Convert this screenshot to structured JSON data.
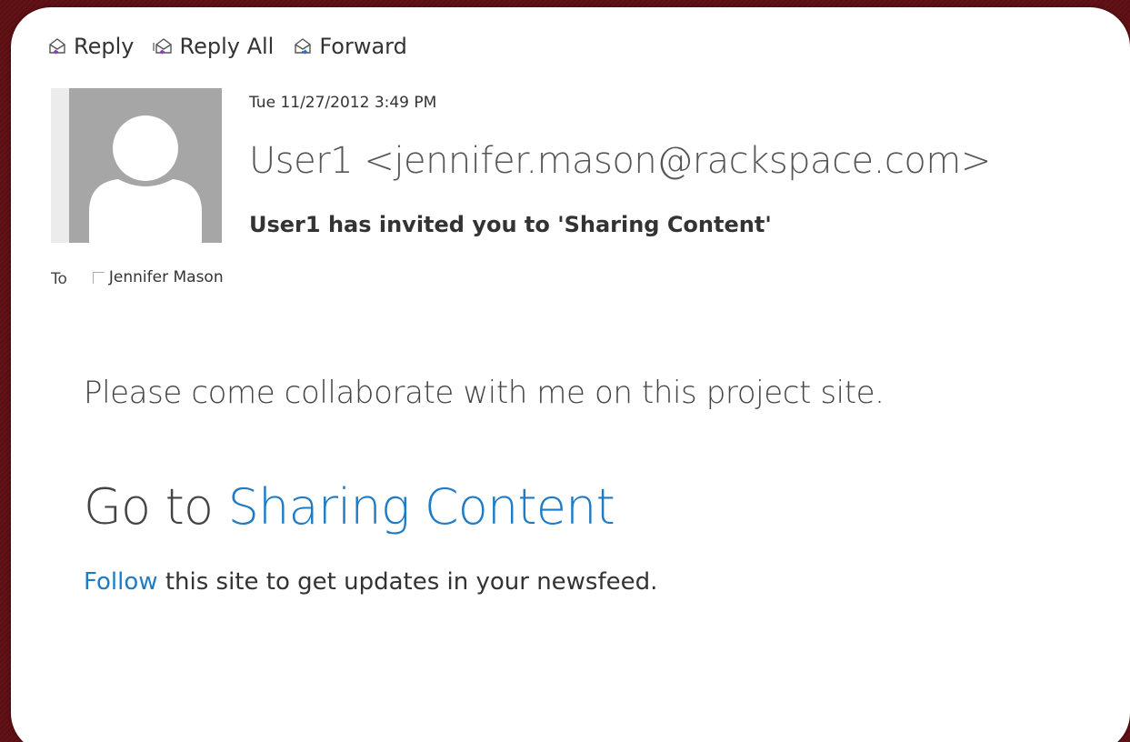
{
  "toolbar": {
    "reply_label": "Reply",
    "reply_all_label": "Reply All",
    "forward_label": "Forward"
  },
  "header": {
    "date": "Tue 11/27/2012 3:49 PM",
    "sender": "User1 <jennifer.mason@rackspace.com>",
    "subject": "User1 has invited you to 'Sharing Content'"
  },
  "recipients": {
    "to_label": "To",
    "to_name": "Jennifer Mason"
  },
  "body": {
    "message": "Please come collaborate with me on this project site.",
    "goto_prefix": "Go to ",
    "goto_link": "Sharing Content",
    "follow_link": "Follow",
    "follow_suffix": " this site to get updates in your newsfeed."
  },
  "colors": {
    "background": "#5e0e13",
    "link": "#1e7bc4",
    "avatar": "#a6a6a6"
  },
  "icons": [
    "reply-icon",
    "reply-all-icon",
    "forward-icon",
    "avatar-silhouette-icon"
  ]
}
